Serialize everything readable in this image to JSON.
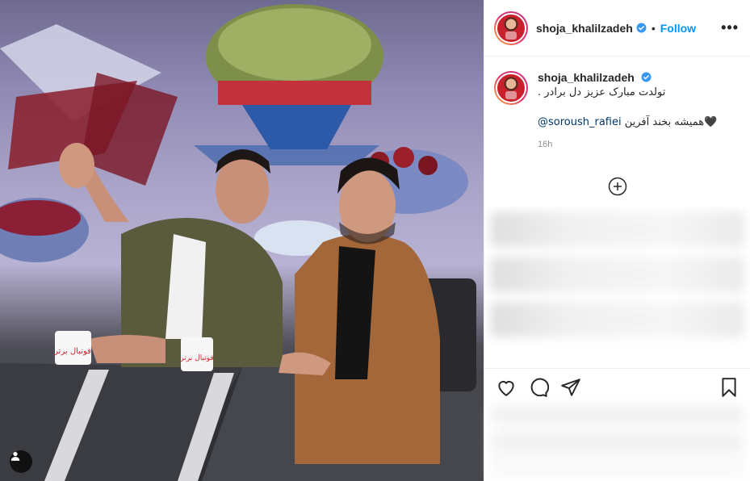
{
  "post": {
    "username": "shoja_khalilzadeh",
    "follow_label": "Follow",
    "separator": "•",
    "more_label": "•••",
    "caption_text": "تولدت مبارک عزیز دل برادر .",
    "caption_line2_prefix": "@soroush_rafiei",
    "caption_line2_suffix": "همیشه بخند آفرین🖤",
    "time_ago": "16h"
  },
  "photo": {
    "mug_text": "فوتبال برتر"
  },
  "icons": {
    "verified": "verified-badge-icon",
    "add_comment": "plus-circle-icon",
    "like": "heart-icon",
    "comment": "comment-icon",
    "share": "send-icon",
    "save": "bookmark-icon",
    "tagged": "user-tag-icon"
  },
  "colors": {
    "accent": "#0095f6",
    "mention": "#00376b",
    "text": "#262626",
    "muted": "#8e8e8e"
  }
}
